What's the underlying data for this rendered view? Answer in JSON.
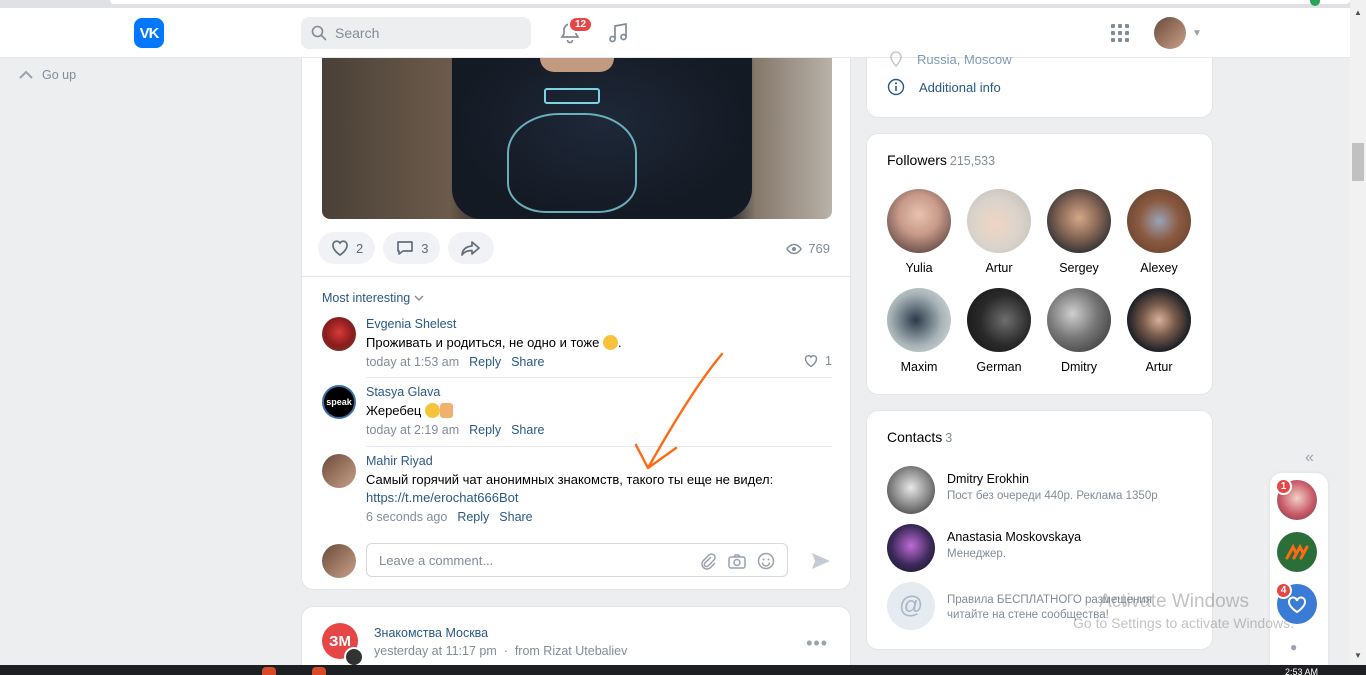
{
  "header": {
    "logo_text": "VK",
    "search_placeholder": "Search",
    "notifications_count": "12"
  },
  "nav": {
    "go_up": "Go up"
  },
  "post": {
    "likes": "2",
    "comments": "3",
    "views": "769",
    "sort_label": "Most interesting",
    "comments_list": [
      {
        "name": "Evgenia Shelest",
        "text": "Проживать и родиться, не одно и тоже",
        "time": "today at 1:53 am",
        "reply": "Reply",
        "share": "Share",
        "likes": "1"
      },
      {
        "name": "Stasya Glava",
        "text": "Жеребец",
        "time": "today at 2:19 am",
        "reply": "Reply",
        "share": "Share",
        "avatar_text": "speak"
      },
      {
        "name": "Mahir Riyad",
        "text": "Самый горячий чат анонимных знакомств, такого ты еще не видел:",
        "link": "https://t.me/erochat666Bot",
        "time": "6 seconds ago",
        "reply": "Reply",
        "share": "Share"
      }
    ],
    "comment_placeholder": "Leave a comment..."
  },
  "next_post": {
    "avatar_text": "ЗМ",
    "name": "Знакомства Москва",
    "time": "yesterday at 11:17 pm",
    "from": "from Rizat Utebaliev"
  },
  "profile_info": {
    "location": "Russia, Moscow",
    "additional_info": "Additional info"
  },
  "followers": {
    "title": "Followers",
    "count": "215,533",
    "items": [
      {
        "name": "Yulia",
        "color": "#c89a8a"
      },
      {
        "name": "Artur",
        "color": "#d9d3cc"
      },
      {
        "name": "Sergey",
        "color": "#3a3f47"
      },
      {
        "name": "Alexey",
        "color": "#8a5a40"
      },
      {
        "name": "Maxim",
        "color": "#a8b4b8"
      },
      {
        "name": "German",
        "color": "#2a2a2a"
      },
      {
        "name": "Dmitry",
        "color": "#777777"
      },
      {
        "name": "Artur",
        "color": "#1c1f26"
      }
    ]
  },
  "contacts": {
    "title": "Contacts",
    "count": "3",
    "items": [
      {
        "name": "Dmitry Erokhin",
        "desc": "Пост без очереди 440р. Реклама 1350р"
      },
      {
        "name": "Anastasia Moskovskaya",
        "desc": "Менеджер."
      },
      {
        "name": "",
        "desc": "Правила БЕСПЛАТНОГО размещения читайте на стене сообщества!"
      }
    ]
  },
  "chat_dock": {
    "badges": [
      "1",
      "4"
    ]
  },
  "watermark": {
    "line1": "Activate Windows",
    "line2": "Go to Settings to activate Windows."
  },
  "taskbar": {
    "time": "2:53 AM"
  },
  "colors": {
    "accent": "#2a5885",
    "vk_blue": "#0077ff",
    "badge_red": "#e64646",
    "annotation_arrow": "#ff6a13"
  }
}
